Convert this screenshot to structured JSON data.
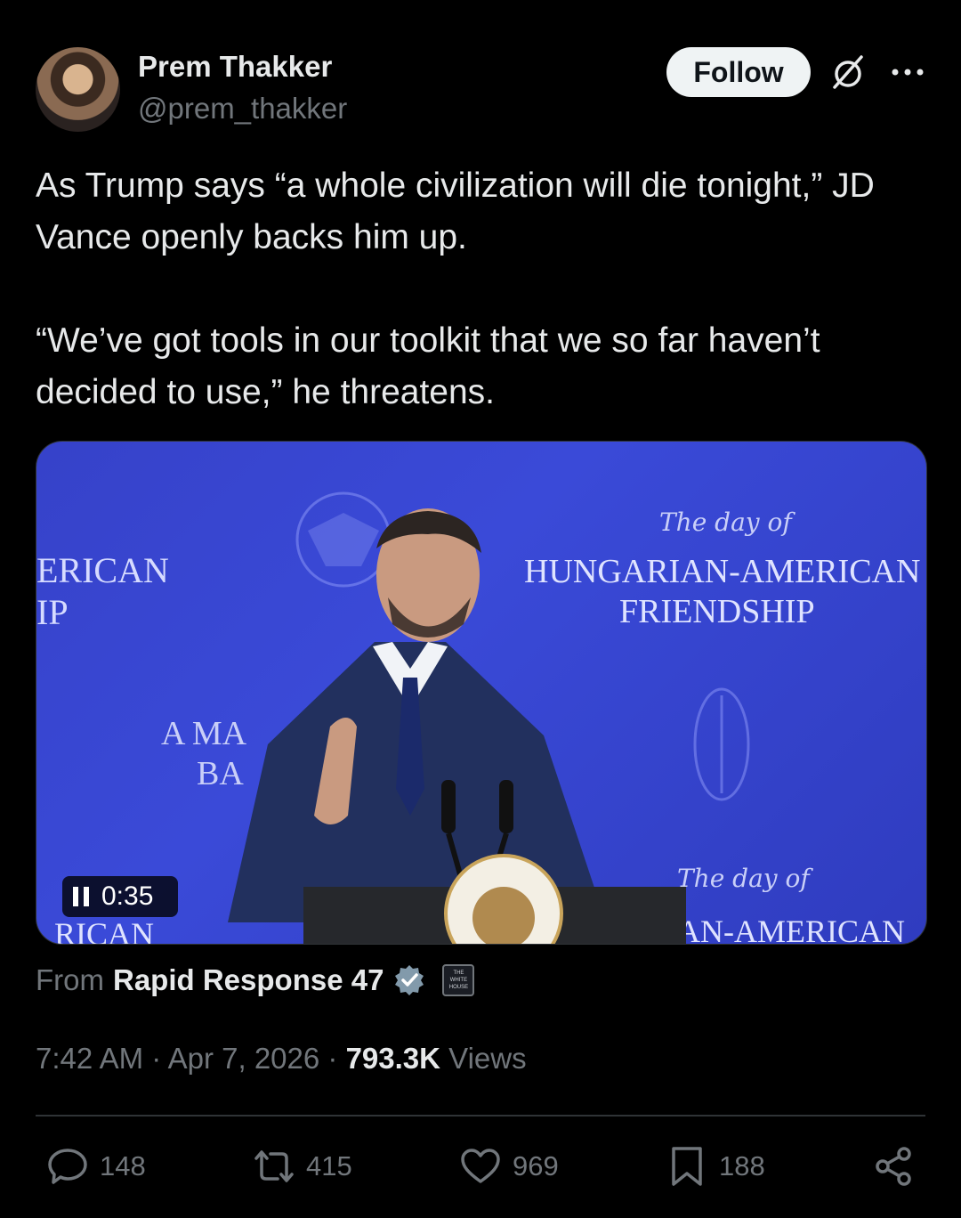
{
  "author": {
    "display_name": "Prem Thakker",
    "handle": "@prem_thakker",
    "follow_label": "Follow"
  },
  "tweet": {
    "paragraph_1": "As Trump says “a whole civilization will die tonight,” JD Vance openly backs him up.",
    "paragraph_2": "“We’ve got tools in our toolkit that we so far haven’t decided to use,” he threatens."
  },
  "media": {
    "timer": "0:35",
    "backdrop_left_lines": [
      "ERICAN",
      "IP"
    ],
    "backdrop_center_lines": [
      "A MA",
      "BA"
    ],
    "backdrop_script_top": "The day of",
    "backdrop_right_lines": [
      "HUNGARIAN-AMERICAN",
      "FRIENDSHIP"
    ],
    "backdrop_script_bottom": "The day of",
    "backdrop_bottom_right": "AN-AMERICAN",
    "backdrop_bottom_left": "RICAN"
  },
  "source": {
    "prefix": "From",
    "name": "Rapid Response 47",
    "badge_text": "THE WHITE HOUSE"
  },
  "meta": {
    "time": "7:42 AM",
    "sep1": "·",
    "date": "Apr 7, 2026",
    "sep2": "·",
    "views_count": "793.3K",
    "views_label": "Views"
  },
  "actions": {
    "replies": "148",
    "reposts": "415",
    "likes": "969",
    "bookmarks": "188"
  },
  "colors": {
    "background": "#000000",
    "text_primary": "#e7e9ea",
    "text_secondary": "#71767b",
    "verified": "#829aab",
    "backdrop_blue": "#3845cf"
  },
  "icons": [
    "grok-icon",
    "more-icon",
    "pause-icon",
    "verified-icon",
    "reply-icon",
    "repost-icon",
    "like-icon",
    "bookmark-icon",
    "share-icon"
  ]
}
